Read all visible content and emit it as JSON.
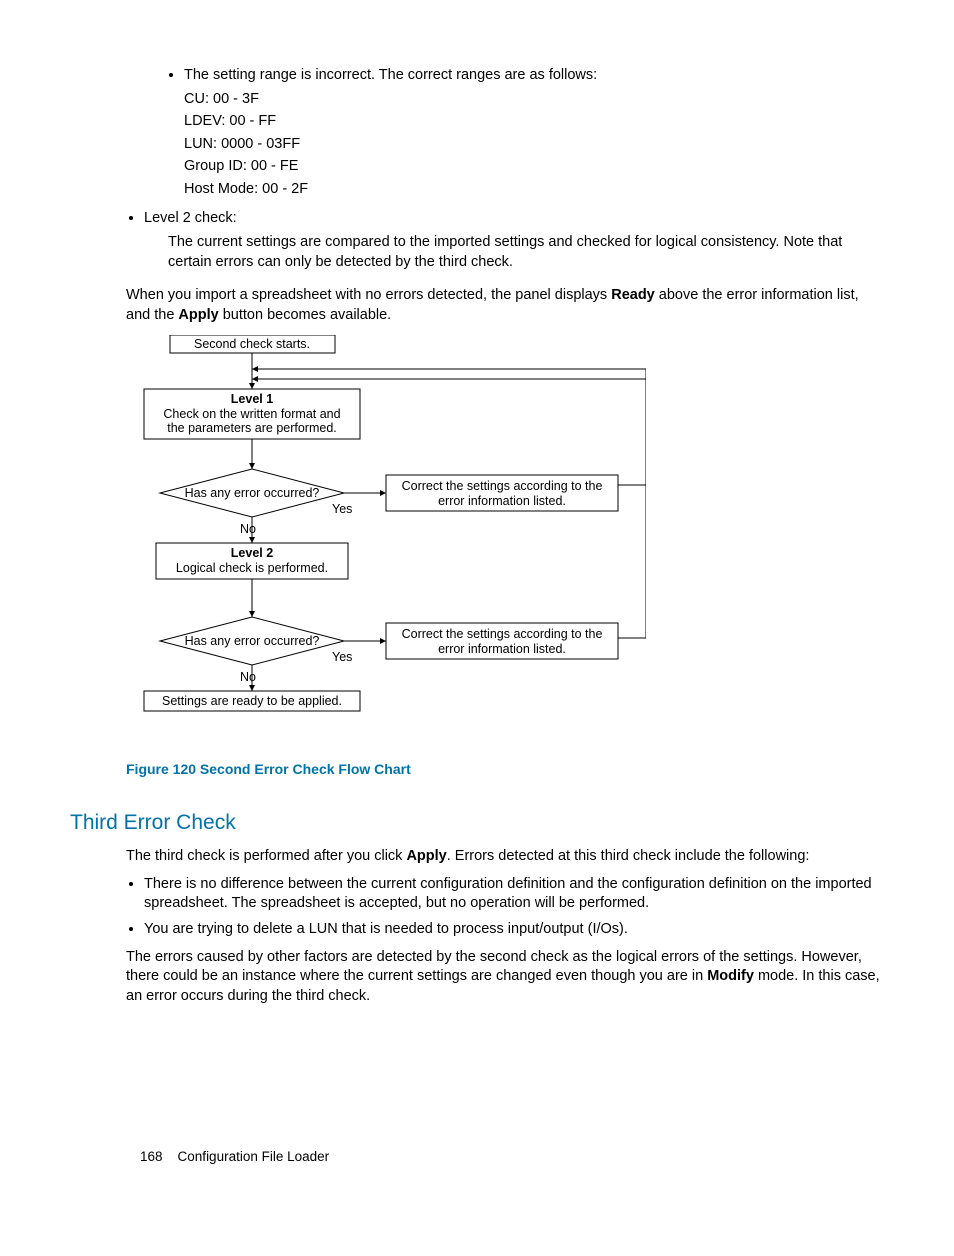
{
  "bullet1": {
    "intro": "The setting range is incorrect. The correct ranges are as follows:",
    "lines": [
      "CU: 00 - 3F",
      "LDEV: 00 - FF",
      "LUN: 0000 - 03FF",
      "Group ID: 00 - FE",
      "Host Mode: 00 - 2F"
    ]
  },
  "level2": {
    "label": "Level 2 check:",
    "body": "The current settings are compared to the imported settings and checked for logical consistency. Note that certain errors can only be detected by the third check."
  },
  "import_para": {
    "pre1": "When you import a spreadsheet with no errors detected, the panel displays ",
    "bold1": "Ready",
    "mid1": " above the error information list, and the ",
    "bold2": "Apply",
    "post1": " button becomes available."
  },
  "diagram": {
    "start": "Second check starts.",
    "level1_title": "Level 1",
    "level1_body1": "Check on the written format and",
    "level1_body2": "the parameters are performed.",
    "decision1": "Has any error occurred?",
    "yes": "Yes",
    "no": "No",
    "correct1a": "Correct the settings according to the",
    "correct1b": "error information listed.",
    "level2_title": "Level 2",
    "level2_body": "Logical check is performed.",
    "decision2": "Has any error occurred?",
    "correct2a": "Correct the settings according to the",
    "correct2b": "error information listed.",
    "ready": "Settings are ready to be applied."
  },
  "figure_caption": "Figure 120 Second Error Check Flow Chart",
  "third_heading": "Third Error Check",
  "third_intro": {
    "pre": "The third check is performed after you click ",
    "bold": "Apply",
    "post": ". Errors detected at this third check include the following:"
  },
  "third_bullets": [
    "There is no difference between the current configuration definition and the configuration definition on the imported spreadsheet. The spreadsheet is accepted, but no operation will be performed.",
    "You are trying to delete a LUN that is needed to process input/output (I/Os)."
  ],
  "third_para2": {
    "pre": "The errors caused by other factors are detected by the second check as the logical errors of the settings. However, there could be an instance where the current settings are changed even though you are in ",
    "bold": "Modify",
    "post": " mode. In this case, an error occurs during the third check."
  },
  "footer": {
    "page": "168",
    "section": "Configuration File Loader"
  }
}
